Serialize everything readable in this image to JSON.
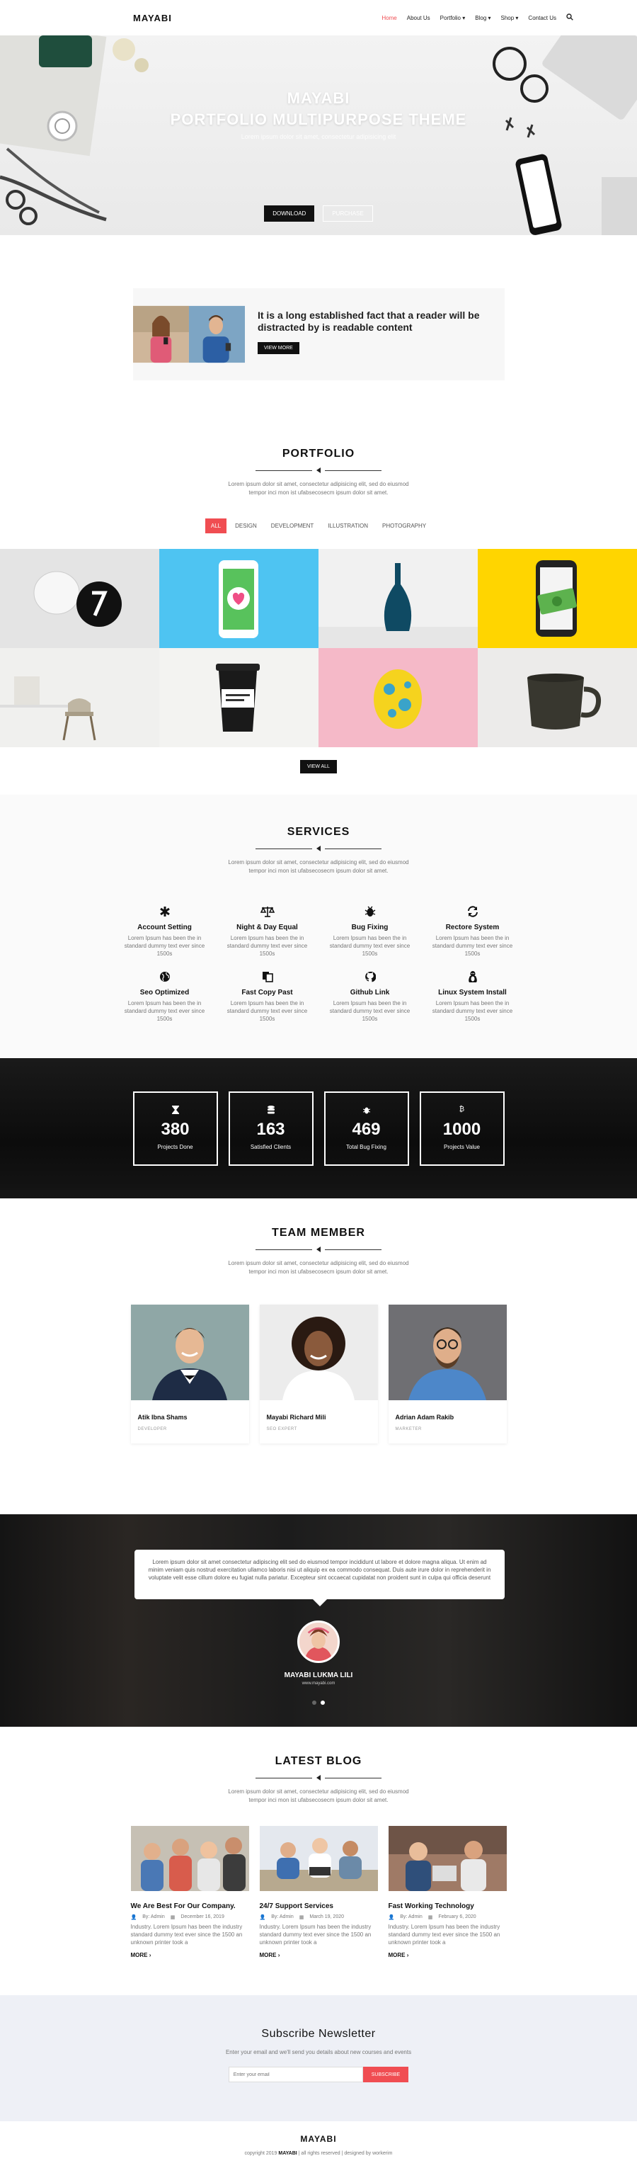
{
  "nav": {
    "logo": "MAYABI",
    "items": [
      "Home",
      "About Us",
      "Portfolio ▾",
      "Blog ▾",
      "Shop ▾",
      "Contact Us"
    ],
    "search_icon": "search-icon"
  },
  "hero": {
    "title": "MAYABI",
    "subtitle": "PORTFOLIO MULTIPURPOSE THEME",
    "tagline": "Lorem ipsum dolor sit amet, consectetur adipisicing elit",
    "download_label": "DOWNLOAD",
    "purchase_label": "PURCHASE"
  },
  "about": {
    "heading": "It is a long established fact that a reader will be distracted by is readable content",
    "button_label": "VIEW MORE"
  },
  "portfolio": {
    "title": "PORTFOLIO",
    "desc": "Lorem ipsum dolor sit amet, consectetur adipisicing elit, sed do eiusmod tempor inci mon ist ufabsecosecm ipsum dolor sit amet.",
    "filters": [
      "ALL",
      "DESIGN",
      "DEVELOPMENT",
      "ILLUSTRATION",
      "PHOTOGRAPHY"
    ],
    "view_all": "VIEW ALL"
  },
  "services": {
    "title": "SERVICES",
    "desc": "Lorem ipsum dolor sit amet, consectetur adipisicing elit, sed do eiusmod tempor inci mon ist ufabsecosecm ipsum dolor sit amet.",
    "items": [
      {
        "title": "Account Setting",
        "text": "Lorem Ipsum has been the in standard dummy text ever since 1500s",
        "icon": "asterisk-icon"
      },
      {
        "title": "Night & Day Equal",
        "text": "Lorem Ipsum has been the in standard dummy text ever since 1500s",
        "icon": "balance-scale-icon"
      },
      {
        "title": "Bug Fixing",
        "text": "Lorem Ipsum has been the in standard dummy text ever since 1500s",
        "icon": "bug-icon"
      },
      {
        "title": "Rectore System",
        "text": "Lorem Ipsum has been the in standard dummy text ever since 1500s",
        "icon": "refresh-icon"
      },
      {
        "title": "Seo Optimized",
        "text": "Lorem Ipsum has been the in standard dummy text ever since 1500s",
        "icon": "globe-icon"
      },
      {
        "title": "Fast Copy Past",
        "text": "Lorem Ipsum has been the in standard dummy text ever since 1500s",
        "icon": "copy-icon"
      },
      {
        "title": "Github Link",
        "text": "Lorem Ipsum has been the in standard dummy text ever since 1500s",
        "icon": "github-icon"
      },
      {
        "title": "Linux System Install",
        "text": "Lorem Ipsum has been the in standard dummy text ever since 1500s",
        "icon": "linux-icon"
      }
    ]
  },
  "counters": [
    {
      "num": "380",
      "label": "Projects Done",
      "icon": "hourglass-icon"
    },
    {
      "num": "163",
      "label": "Satisfied Clients",
      "icon": "database-icon"
    },
    {
      "num": "469",
      "label": "Total Bug Fixing",
      "icon": "bug-icon"
    },
    {
      "num": "1000",
      "label": "Projects Value",
      "icon": "bitcoin-icon"
    }
  ],
  "team": {
    "title": "TEAM MEMBER",
    "desc": "Lorem ipsum dolor sit amet, consectetur adipisicing elit, sed do eiusmod tempor inci mon ist ufabsecosecm ipsum dolor sit amet.",
    "members": [
      {
        "name": "Atik Ibna Shams",
        "role": "DEVELOPER"
      },
      {
        "name": "Mayabi Richard Mili",
        "role": "SEO EXPERT"
      },
      {
        "name": "Adrian Adam Rakib",
        "role": "MARKETER"
      }
    ]
  },
  "testimonial": {
    "quote": "Lorem ipsum dolor sit amet consectetur adipiscing elit sed do eiusmod tempor incididunt ut labore et dolore magna aliqua. Ut enim ad minim veniam quis nostrud exercitation ullamco laboris nisi ut aliquip ex ea commodo consequat. Duis aute irure dolor in reprehenderit in voluptate velit esse cillum dolore eu fugiat nulla pariatur. Excepteur sint occaecat cupidatat non proident sunt in culpa qui officia deserunt",
    "name": "MAYABI LUKMA LILI",
    "site": "www.mayabi.com"
  },
  "blog": {
    "title": "LATEST BLOG",
    "desc": "Lorem ipsum dolor sit amet, consectetur adipisicing elit, sed do eiusmod tempor inci mon ist ufabsecosecm ipsum dolor sit amet.",
    "posts": [
      {
        "title": "We Are Best For Our Company.",
        "author": "By: Admin",
        "date": "December 16, 2019",
        "text": "Industry. Lorem Ipsum has been the industry standard dummy text ever since the 1500 an unknown printer took a",
        "more": "MORE ›"
      },
      {
        "title": "24/7 Support Services",
        "author": "By: Admin",
        "date": "March 19, 2020",
        "text": "Industry. Lorem Ipsum has been the industry standard dummy text ever since the 1500 an unknown printer took a",
        "more": "MORE ›"
      },
      {
        "title": "Fast Working Technology",
        "author": "By: Admin",
        "date": "February 6, 2020",
        "text": "Industry. Lorem Ipsum has been the industry standard dummy text ever since the 1500 an unknown printer took a",
        "more": "MORE ›"
      }
    ]
  },
  "subscribe": {
    "title": "Subscribe Newsletter",
    "desc": "Enter your email and we'll send you details about new courses and events",
    "placeholder": "Enter your email",
    "button": "SUBSCRIBE"
  },
  "footer": {
    "logo": "MAYABI",
    "copy_pre": "copyright 2019",
    "copy_brand": "MAYABI",
    "copy_post": "| all rights reserved | designed by workerim"
  },
  "colors": {
    "accent": "#f04d52",
    "dark": "#111111"
  }
}
